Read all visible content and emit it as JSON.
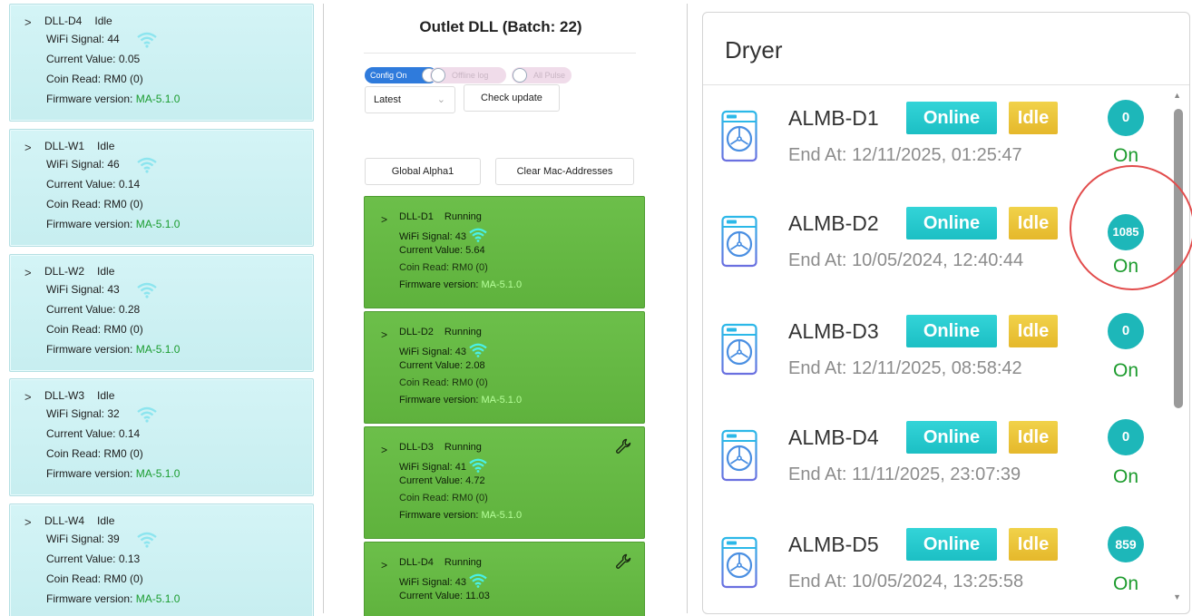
{
  "left_panel": {
    "labels": {
      "wifi": "WiFi Signal:",
      "current": "Current Value:",
      "coin": "Coin Read:",
      "firmware": "Firmware version:"
    },
    "cards": [
      {
        "name": "DLL-D4",
        "status": "Idle",
        "wifi": "44",
        "current": "0.05",
        "coin": "RM0 (0)",
        "firmware": "MA-5.1.0"
      },
      {
        "name": "DLL-W1",
        "status": "Idle",
        "wifi": "46",
        "current": "0.14",
        "coin": "RM0 (0)",
        "firmware": "MA-5.1.0"
      },
      {
        "name": "DLL-W2",
        "status": "Idle",
        "wifi": "43",
        "current": "0.28",
        "coin": "RM0 (0)",
        "firmware": "MA-5.1.0"
      },
      {
        "name": "DLL-W3",
        "status": "Idle",
        "wifi": "32",
        "current": "0.14",
        "coin": "RM0 (0)",
        "firmware": "MA-5.1.0"
      },
      {
        "name": "DLL-W4",
        "status": "Idle",
        "wifi": "39",
        "current": "0.13",
        "coin": "RM0 (0)",
        "firmware": "MA-5.1.0"
      }
    ]
  },
  "middle_panel": {
    "title": "Outlet DLL (Batch: 22)",
    "toggles": [
      {
        "label": "Config On",
        "state": "on"
      },
      {
        "label": "Offline log",
        "state": "off"
      },
      {
        "label": "All Pulse",
        "state": "off"
      }
    ],
    "version_select": "Latest",
    "check_update_label": "Check update",
    "global_alpha_label": "Global Alpha1",
    "clear_mac_label": "Clear Mac-Addresses",
    "labels": {
      "wifi": "WiFi Signal:",
      "current": "Current Value:",
      "coin": "Coin Read:",
      "firmware": "Firmware version:"
    },
    "cards": [
      {
        "name": "DLL-D1",
        "status": "Running",
        "wifi": "43",
        "current": "5.64",
        "coin": "RM0 (0)",
        "firmware": "MA-5.1.0"
      },
      {
        "name": "DLL-D2",
        "status": "Running",
        "wifi": "43",
        "current": "2.08",
        "coin": "RM0 (0)",
        "firmware": "MA-5.1.0"
      },
      {
        "name": "DLL-D3",
        "status": "Running",
        "wifi": "41",
        "current": "4.72",
        "coin": "RM0 (0)",
        "firmware": "MA-5.1.0"
      },
      {
        "name": "DLL-D4",
        "status": "Running",
        "wifi": "43",
        "current": "11.03"
      }
    ]
  },
  "right_panel": {
    "title": "Dryer",
    "end_at_label": "End At:",
    "rows": [
      {
        "name": "ALMB-D1",
        "online": "Online",
        "idle": "Idle",
        "end_at": "12/11/2025, 01:25:47",
        "count": "0",
        "state": "On"
      },
      {
        "name": "ALMB-D2",
        "online": "Online",
        "idle": "Idle",
        "end_at": "10/05/2024, 12:40:44",
        "count": "1085",
        "state": "On"
      },
      {
        "name": "ALMB-D3",
        "online": "Online",
        "idle": "Idle",
        "end_at": "12/11/2025, 08:58:42",
        "count": "0",
        "state": "On"
      },
      {
        "name": "ALMB-D4",
        "online": "Online",
        "idle": "Idle",
        "end_at": "11/11/2025, 23:07:39",
        "count": "0",
        "state": "On"
      },
      {
        "name": "ALMB-D5",
        "online": "Online",
        "idle": "Idle",
        "end_at": "10/05/2024, 13:25:58",
        "count": "859",
        "state": "On"
      }
    ],
    "highlighted_row": "ALMB-D2"
  },
  "colors": {
    "left_card_bg": "#d4f4f6",
    "running_card_bg": "#6cbf4a",
    "online_badge": "#1cbfc4",
    "idle_badge": "#e5b82b",
    "count_badge": "#1db7b9",
    "on_text": "#1c9b2d",
    "firmware_green": "#1a9c2e",
    "toggle_on": "#2f7bdc",
    "highlight_circle": "#e24c4c"
  },
  "icons": {
    "wifi": "wifi-icon",
    "machine": "washing-machine-icon",
    "wrench": "wrench-icon",
    "chevron": "chevron-right-icon"
  }
}
